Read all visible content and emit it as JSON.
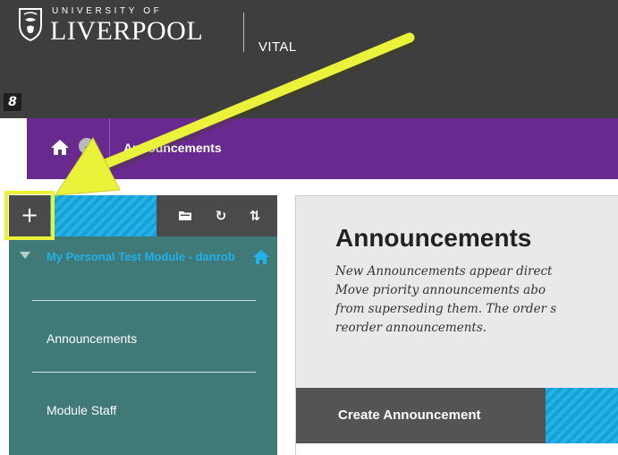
{
  "header": {
    "university_small": "UNIVERSITY OF",
    "university_big": "LIVERPOOL",
    "app_name": "VITAL",
    "link_icon_glyph": "8"
  },
  "breadcrumb": {
    "current": "Announcements",
    "toggle_glyph": "⌄"
  },
  "menu": {
    "toolbar": {
      "add_glyph": "+",
      "folder_icon": "folder-icon",
      "refresh_glyph": "↻",
      "sort_glyph": "⇅"
    },
    "course_title": "My Personal Test Module - danrob",
    "items": [
      {
        "label": "Announcements"
      },
      {
        "label": "Module Staff"
      }
    ]
  },
  "main": {
    "title": "Announcements",
    "description_lines": [
      "New Announcements appear direct",
      "Move priority announcements abo",
      "from superseding them. The order s",
      "reorder announcements."
    ],
    "create_button": "Create Announcement"
  },
  "colors": {
    "header_bg": "#3e3e3e",
    "breadcrumb_bg": "#682a8e",
    "menu_bg": "#3f7a79",
    "menu_link": "#21b0e8",
    "accent_blue": "#16a0d8",
    "button_dark": "#545454",
    "annotation_yellow": "#eaf23a"
  }
}
